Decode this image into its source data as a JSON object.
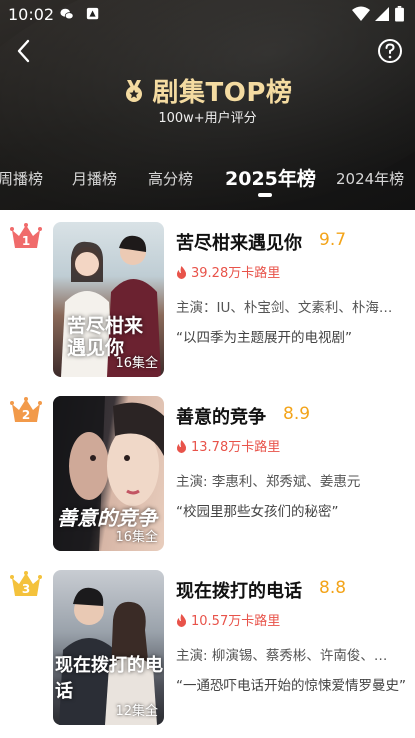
{
  "status_bar": {
    "time": "10:02"
  },
  "header": {
    "title": "剧集TOP榜",
    "subtitle": "100w+用户评分",
    "tabs": [
      {
        "label": "周播榜",
        "active": false
      },
      {
        "label": "月播榜",
        "active": false
      },
      {
        "label": "高分榜",
        "active": false
      },
      {
        "label": "2025年榜",
        "active": true
      },
      {
        "label": "2024年榜",
        "active": false
      }
    ]
  },
  "colors": {
    "accent_gold": "#f4dba1",
    "score": "#f3a41a",
    "heat": "#e8534a"
  },
  "items": [
    {
      "rank": "1",
      "title": "苦尽柑来遇见你",
      "score": "9.7",
      "heat": "39.28万卡路里",
      "cast": "主演：IU、朴宝剑、文素利、朴海…",
      "quote": "“以四季为主题展开的电视剧”",
      "episodes": "16集全",
      "poster_title": "苦尽柑来遇见你",
      "crown_color": "#f06b6b"
    },
    {
      "rank": "2",
      "title": "善意的竞争",
      "score": "8.9",
      "heat": "13.78万卡路里",
      "cast": "主演: 李惠利、郑秀斌、姜惠元",
      "quote": "“校园里那些女孩们的秘密”",
      "episodes": "16集全",
      "poster_title": "善意的竞争",
      "crown_color": "#f29a4a"
    },
    {
      "rank": "3",
      "title": "现在拨打的电话",
      "score": "8.8",
      "heat": "10.57万卡路里",
      "cast": "主演: 柳演锡、蔡秀彬、许南俊、…",
      "quote": "“一通恐吓电话开始的惊悚爱情罗曼史”",
      "episodes": "12集全",
      "poster_title": "现在拨打的电话",
      "crown_color": "#f4c23c"
    }
  ]
}
